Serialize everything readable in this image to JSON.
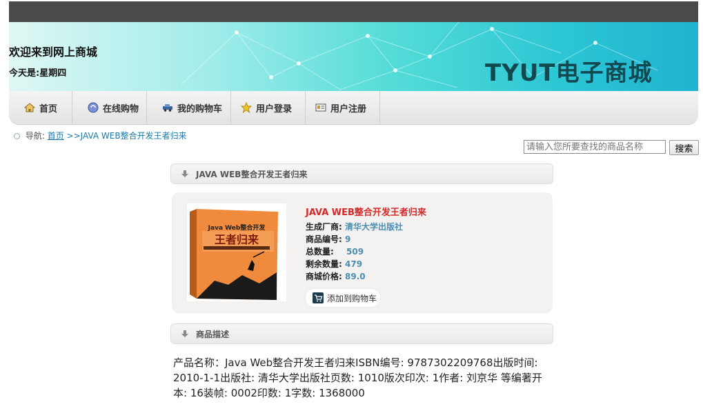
{
  "header": {
    "welcome": "欢迎来到网上商城",
    "today": "今天是:星期四",
    "brand": "TYUT电子商城"
  },
  "nav": {
    "items": [
      {
        "label": "首页",
        "icon": "home-icon"
      },
      {
        "label": "在线购物",
        "icon": "shopping-icon"
      },
      {
        "label": "我的购物车",
        "icon": "cart-car-icon"
      },
      {
        "label": "用户登录",
        "icon": "star-icon"
      },
      {
        "label": "用户注册",
        "icon": "register-card-icon"
      }
    ]
  },
  "breadcrumb": {
    "prefix": "导航:",
    "home": "首页",
    "current": ">>JAVA WEB整合开发王者归来"
  },
  "search": {
    "placeholder": "请输入您所要查找的商品名称",
    "button": "搜索"
  },
  "product": {
    "panel_title": "JAVA WEB整合开发王者归来",
    "name": "JAVA WEB整合开发王者归来",
    "cover_title": "Java Web整合开发",
    "cover_big": "王者归来",
    "fields": [
      {
        "label": "生成厂商:",
        "value": "清华大学出版社"
      },
      {
        "label": "商品编号:",
        "value": "9"
      },
      {
        "label": "总数量:",
        "value": "509"
      },
      {
        "label": "剩余数量:",
        "value": "479"
      },
      {
        "label": "商城价格:",
        "value": "89.0"
      }
    ],
    "add_to_cart": "添加到购物车"
  },
  "description": {
    "panel_title": "商品描述",
    "text": "产品名称：Java Web整合开发王者归来ISBN编号: 9787302209768出版时间: 2010-1-1出版社: 清华大学出版社页数: 1010版次印次: 1作者: 刘京华 等编著开本: 16装帧: 0002印数: 1字数: 1368000"
  }
}
